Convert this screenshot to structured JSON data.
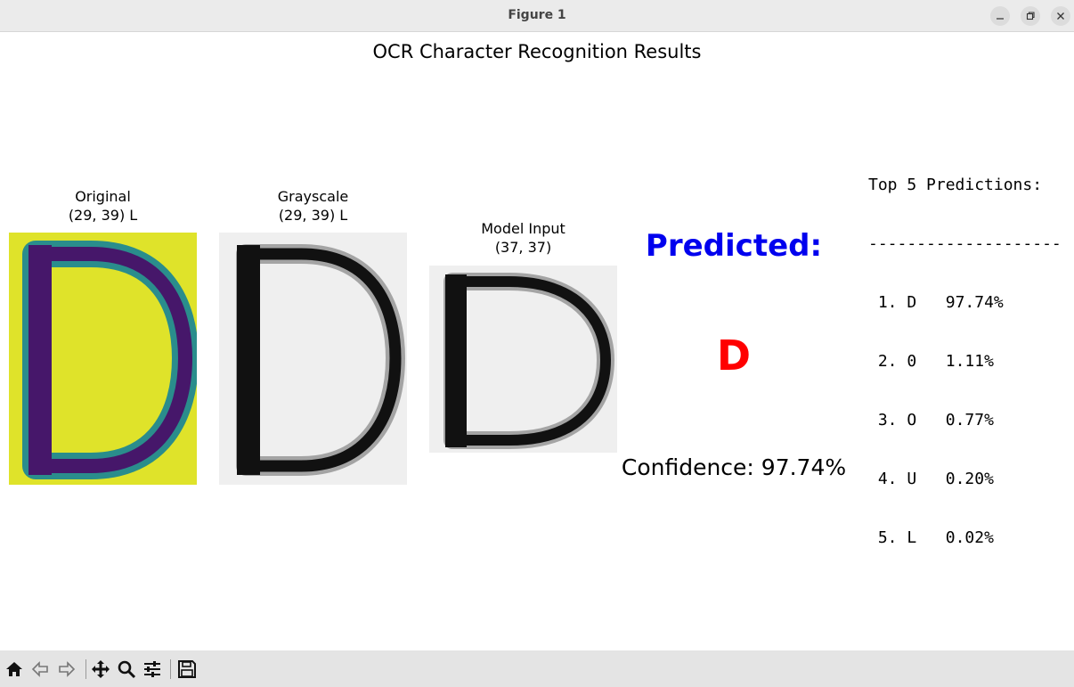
{
  "window": {
    "title": "Figure 1",
    "controls": [
      "minimize-icon",
      "maximize-icon",
      "close-icon"
    ]
  },
  "figure": {
    "title": "OCR Character Recognition Results",
    "panels": [
      {
        "title_line1": "Original",
        "title_line2": "(29, 39) L",
        "image": "letter D rendered with viridis colormap (yellow background, purple letter)"
      },
      {
        "title_line1": "Grayscale",
        "title_line2": "(29, 39) L",
        "image": "letter D in grayscale (black on light gray)"
      },
      {
        "title_line1": "Model Input",
        "title_line2": "(37, 37)",
        "image": "letter D resized to square model input"
      }
    ],
    "prediction": {
      "label": "Predicted:",
      "character": "D",
      "confidence_text": "Confidence: 97.74%"
    },
    "top5": {
      "header": "Top 5 Predictions:",
      "separator": "--------------------",
      "items": [
        {
          "rank": "1.",
          "char": "D",
          "prob": "97.74%"
        },
        {
          "rank": "2.",
          "char": "0",
          "prob": "1.11%"
        },
        {
          "rank": "3.",
          "char": "O",
          "prob": "0.77%"
        },
        {
          "rank": "4.",
          "char": "U",
          "prob": "0.20%"
        },
        {
          "rank": "5.",
          "char": "L",
          "prob": "0.02%"
        }
      ]
    }
  },
  "colors": {
    "predicted_label": "#0000ee",
    "predicted_char": "#ff0000",
    "viridis_bg": "#dfe32a",
    "viridis_mid": "#2a8d8c",
    "viridis_dark": "#46176a"
  },
  "toolbar": {
    "icons": [
      "home-icon",
      "back-arrow-icon",
      "forward-arrow-icon",
      "pan-move-icon",
      "zoom-magnifier-icon",
      "configure-subplots-icon",
      "save-floppy-icon"
    ]
  }
}
